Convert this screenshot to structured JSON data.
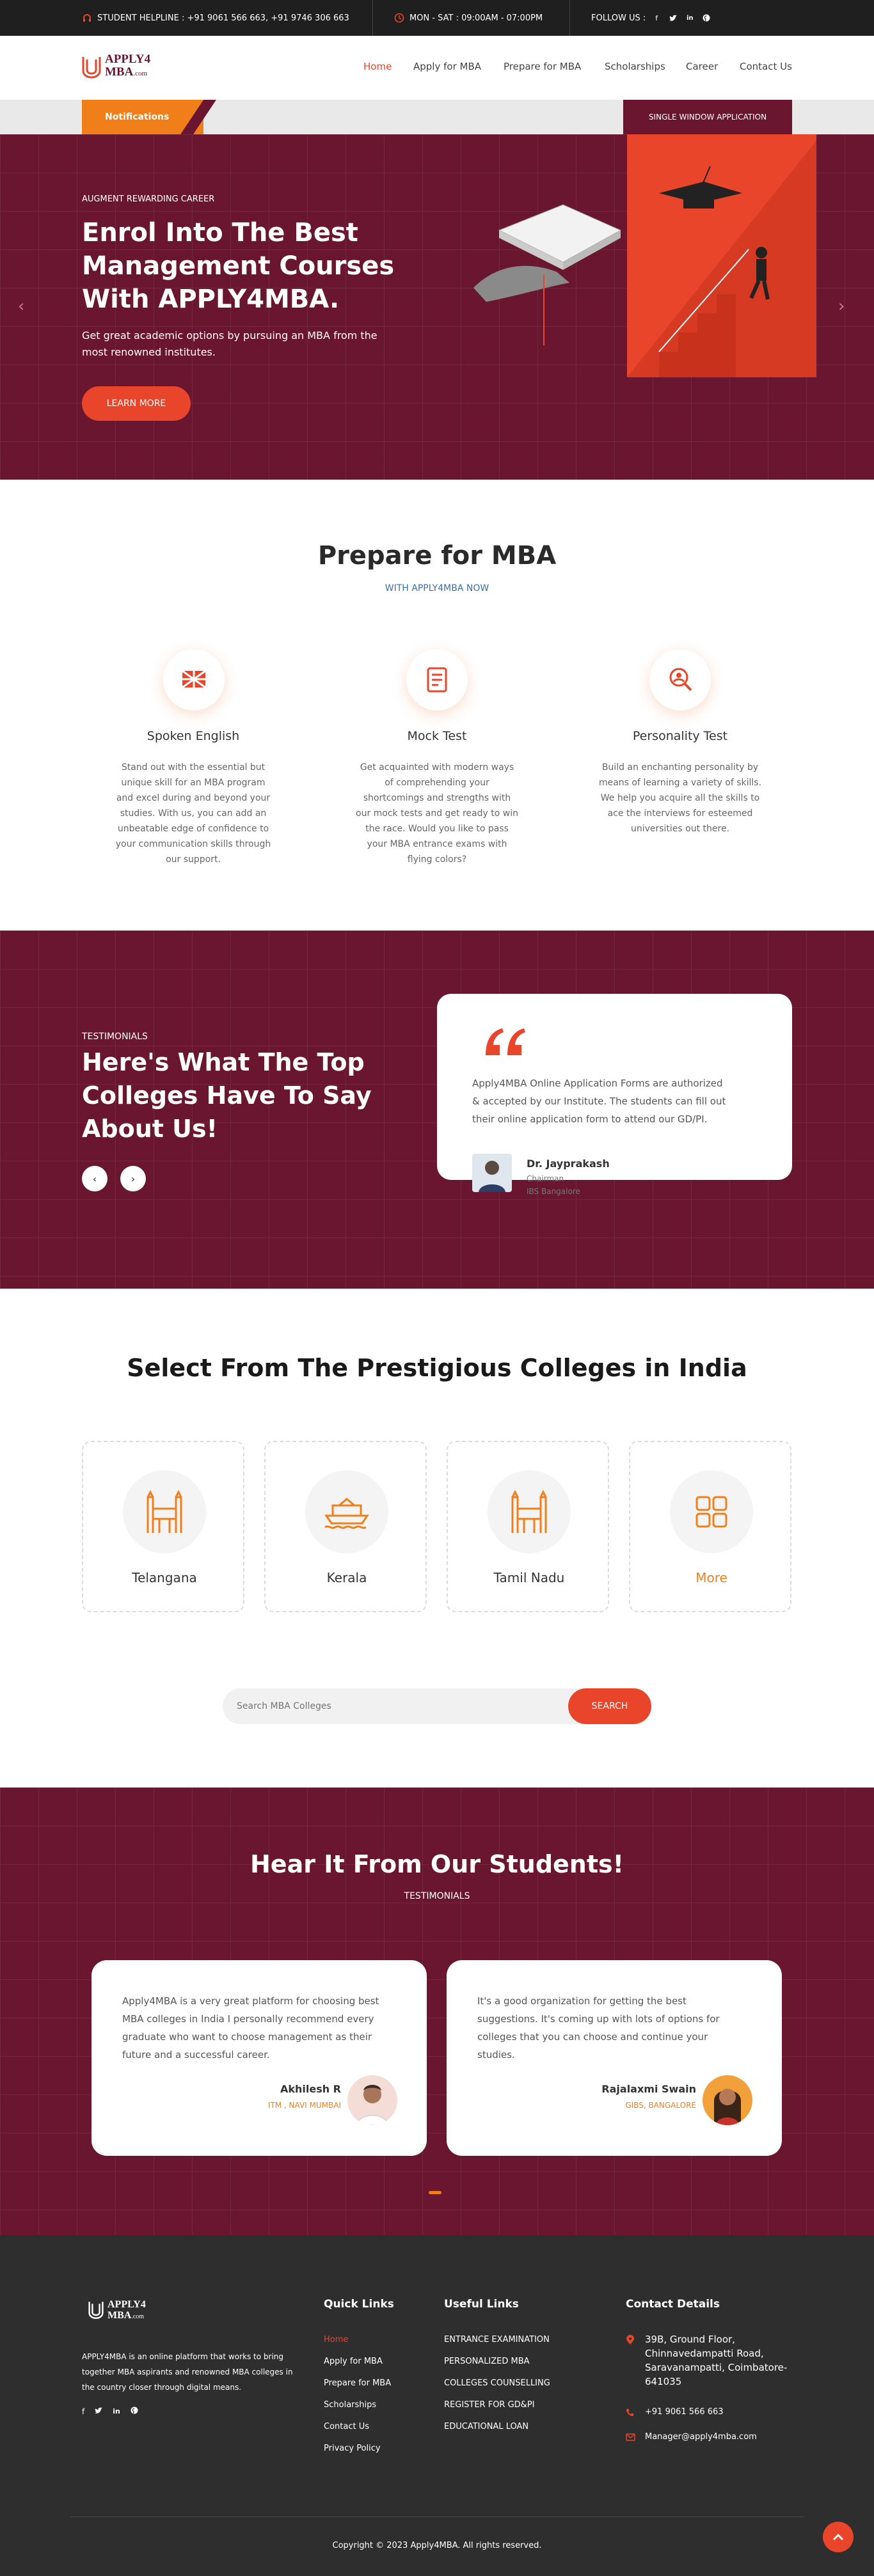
{
  "topbar": {
    "helpline": "STUDENT HELPLINE : +91 9061 566 663, +91 9746 306 663",
    "hours": "MON - SAT : 09:00AM - 07:00PM",
    "follow": "FOLLOW US :",
    "social_icons": [
      "facebook-icon",
      "twitter-icon",
      "linkedin-icon",
      "pinterest-icon"
    ]
  },
  "brand": {
    "line1": "APPLY4",
    "line2": "MBA",
    "suffix": ".com",
    "accent": "#e8452a",
    "maroon": "#6b1630",
    "orange": "#f07f1a"
  },
  "nav": [
    "Home",
    "Apply for MBA",
    "Prepare for MBA",
    "Scholarships",
    "Career",
    "Contact Us"
  ],
  "notifications": {
    "label": "Notifications",
    "single_window": "SINGLE WINDOW APPLICATION"
  },
  "hero": {
    "eyebrow": "AUGMENT REWARDING CAREER",
    "title_l1": "Enrol Into The Best",
    "title_l2": "Management Courses",
    "title_l3": "With APPLY4MBA.",
    "subtitle_l1": "Get great academic options by pursuing an MBA from the",
    "subtitle_l2": "most renowned institutes.",
    "cta": "LEARN MORE"
  },
  "prepare": {
    "title": "Prepare for MBA",
    "subtitle": "WITH APPLY4MBA NOW",
    "cards": [
      {
        "title": "Spoken English",
        "lines": [
          "Stand out with the essential but",
          "unique skill for an MBA program",
          "and excel during and beyond your",
          "studies. With us, you can add an",
          "unbeatable edge of confidence to",
          "your communication skills through",
          "our support."
        ]
      },
      {
        "title": "Mock Test",
        "lines": [
          "Get acquainted with modern ways",
          "of comprehending your",
          "shortcomings and strengths with",
          "our mock tests and get ready to win",
          "the race. Would you like to pass",
          "your MBA entrance exams with",
          "flying colors?"
        ]
      },
      {
        "title": "Personality Test",
        "lines": [
          "Build an enchanting personality by",
          "means of learning a variety of skills.",
          "We help you acquire all the skills to",
          "ace the interviews for esteemed",
          "universities out there."
        ]
      }
    ]
  },
  "testimonials": {
    "eyebrow": "TESTIMONIALS",
    "title_l1": "Here's What The Top",
    "title_l2": "Colleges Have To Say",
    "title_l3": "About Us!",
    "quote_lines": [
      "Apply4MBA Online Application Forms are authorized",
      "& accepted by our Institute. The students can fill out",
      "their online application form to attend our GD/PI."
    ],
    "name": "Dr. Jayprakash",
    "role": "Chairman",
    "org": "IBS Bangalore"
  },
  "colleges": {
    "title": "Select From The Prestigious Colleges in India",
    "items": [
      {
        "name": "Telangana",
        "icon": "charminar-icon"
      },
      {
        "name": "Kerala",
        "icon": "houseboat-icon"
      },
      {
        "name": "Tamil Nadu",
        "icon": "temple-icon"
      },
      {
        "name": "More",
        "icon": "grid-icon"
      }
    ],
    "search_placeholder": "Search MBA Colleges",
    "search_button": "SEARCH"
  },
  "students": {
    "title": "Hear It From Our Students!",
    "subtitle": "TESTIMONIALS",
    "items": [
      {
        "lines": [
          "Apply4MBA is a very great platform for choosing best",
          "MBA colleges in India I personally recommend every",
          "graduate who want to choose management as their",
          "future and a successful career."
        ],
        "name": "Akhilesh R",
        "org": "ITM , NAVI MUMBAI"
      },
      {
        "lines": [
          "It's a good organization for getting the best",
          "suggestions. It's coming up with lots of options for",
          "colleges that you can choose and continue your",
          "studies."
        ],
        "name": "Rajalaxmi Swain",
        "org": "GIBS, BANGALORE"
      }
    ]
  },
  "footer": {
    "about_lines": [
      "APPLY4MBA is an online platform that works to bring",
      "together MBA aspirants and renowned MBA colleges in",
      "the country closer through digital means."
    ],
    "quick_title": "Quick Links",
    "quick_links": [
      "Home",
      "Apply for MBA",
      "Prepare for MBA",
      "Scholarships",
      "Contact Us",
      "Privacy Policy"
    ],
    "useful_title": "Useful Links",
    "useful_links": [
      "ENTRANCE EXAMINATION",
      "PERSONALIZED MBA",
      "COLLEGES COUNSELLING",
      "REGISTER FOR GD&PI",
      "EDUCATIONAL LOAN"
    ],
    "contact_title": "Contact Details",
    "address_lines": [
      "39B, Ground Floor,",
      "Chinnavedampatti Road,",
      "Saravanampatti, Coimbatore-",
      "641035"
    ],
    "phone": "+91 9061 566 663",
    "email": "Manager@apply4mba.com",
    "copyright": "Copyright © 2023 Apply4MBA. All rights reserved."
  }
}
